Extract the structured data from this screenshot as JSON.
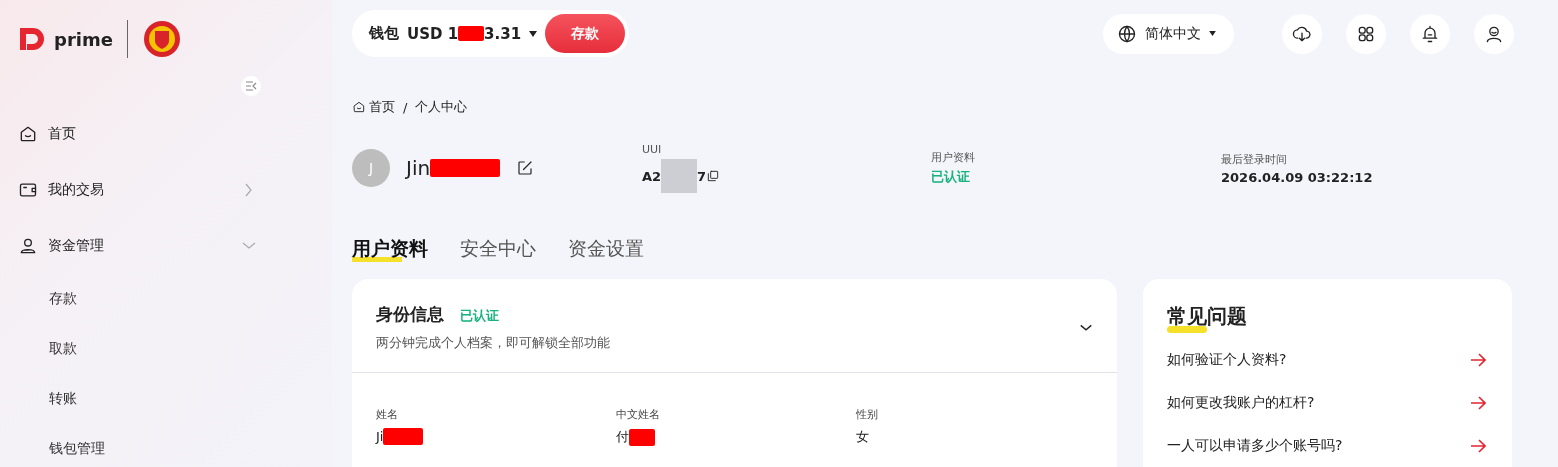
{
  "logo": {
    "text": "prime"
  },
  "wallet": {
    "label": "钱包",
    "amount_prefix": "USD 1",
    "amount_suffix": "3.31",
    "button": "存款"
  },
  "language": {
    "label": "简体中文"
  },
  "sidebar": {
    "items": [
      {
        "label": "首页",
        "kind": "link"
      },
      {
        "label": "我的交易",
        "kind": "group",
        "expanded": false
      },
      {
        "label": "资金管理",
        "kind": "group",
        "expanded": true,
        "children": [
          {
            "label": "存款"
          },
          {
            "label": "取款"
          },
          {
            "label": "转账"
          },
          {
            "label": "钱包管理"
          }
        ]
      }
    ]
  },
  "breadcrumb": [
    "首页",
    "/",
    "个人中心"
  ],
  "profile": {
    "avatar": "J",
    "name_visible": "Jin",
    "uuid_label": "UUI",
    "uuid_start": "A2",
    "uuid_end": "7",
    "info": [
      {
        "label": "用户资料",
        "value": "已认证",
        "kind": "status"
      },
      {
        "label": "最后登录时间",
        "value": "2026.04.09 03:22:12",
        "kind": "text"
      }
    ]
  },
  "tabs": [
    {
      "label": "用户资料",
      "selected": true
    },
    {
      "label": "安全中心",
      "selected": false
    },
    {
      "label": "资金设置",
      "selected": false
    }
  ],
  "identity": {
    "title": "身份信息",
    "badge": "已认证",
    "subtitle": "两分钟完成个人档案，即可解锁全部功能",
    "expanded": true,
    "fields": [
      {
        "label": "姓名",
        "value": "Ji",
        "redacted": true
      },
      {
        "label": "中文姓名",
        "value": "付",
        "redacted": true
      },
      {
        "label": "性别",
        "value": "女",
        "redacted": false
      }
    ]
  },
  "faq": {
    "title_highlight": "常见",
    "title_rest": "问题",
    "items": [
      "如何验证个人资料?",
      "如何更改我账户的杠杆?",
      "一人可以申请多少个账号吗?"
    ]
  }
}
